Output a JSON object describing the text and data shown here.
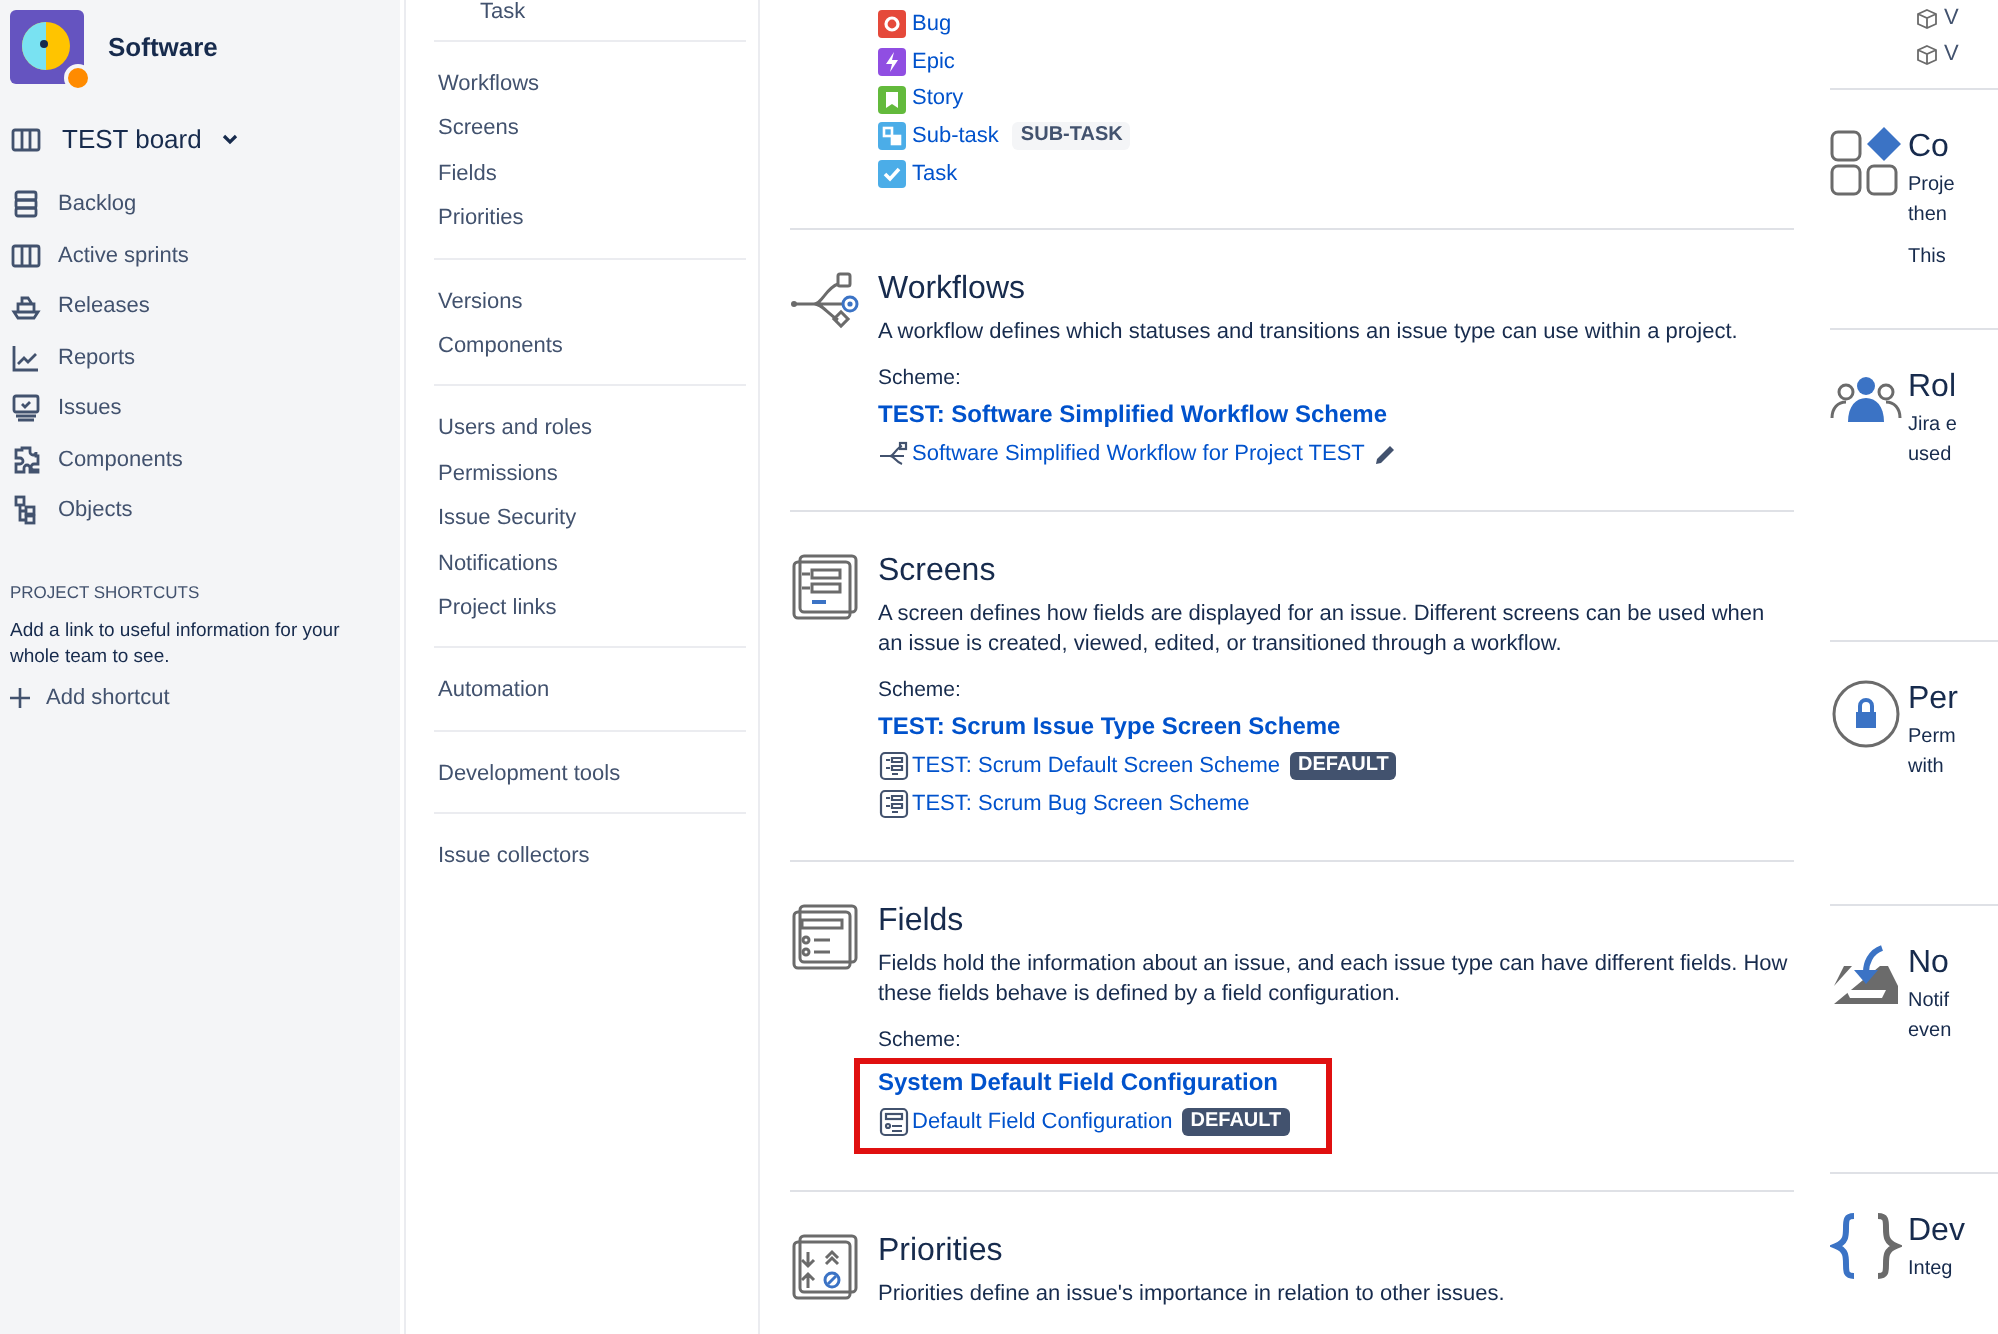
{
  "project": {
    "name": "Software"
  },
  "board": {
    "label": "TEST board"
  },
  "sidebar": {
    "items": [
      {
        "label": "Backlog",
        "kind": "backlog",
        "selected": false
      },
      {
        "label": "Active sprints",
        "kind": "sprints",
        "selected": false
      },
      {
        "label": "Releases",
        "kind": "releases",
        "selected": false
      },
      {
        "label": "Reports",
        "kind": "reports",
        "selected": false
      },
      {
        "label": "Issues",
        "kind": "issues",
        "selected": false
      },
      {
        "label": "Components",
        "kind": "components",
        "selected": false
      },
      {
        "label": "Objects",
        "kind": "objects",
        "selected": false
      }
    ]
  },
  "shortcuts": {
    "heading": "PROJECT SHORTCUTS",
    "text": "Add a link to useful information for your whole team to see.",
    "add": "Add shortcut"
  },
  "settings_nav": {
    "top_item": "Task",
    "groups": [
      [
        "Workflows",
        "Screens",
        "Fields",
        "Priorities"
      ],
      [
        "Versions",
        "Components"
      ],
      [
        "Users and roles",
        "Permissions",
        "Issue Security",
        "Notifications",
        "Project links"
      ],
      [
        "Automation"
      ],
      [
        "Development tools"
      ],
      [
        "Issue collectors"
      ]
    ]
  },
  "issue_types": [
    {
      "name": "Bug",
      "kind": "bug"
    },
    {
      "name": "Epic",
      "kind": "epic"
    },
    {
      "name": "Story",
      "kind": "story"
    },
    {
      "name": "Sub-task",
      "kind": "subtask",
      "badge": "SUB-TASK"
    },
    {
      "name": "Task",
      "kind": "task"
    }
  ],
  "sections": [
    {
      "kind": "workflows",
      "title": "Workflows",
      "description": "A workflow defines which statuses and transitions an issue type can use within a project.",
      "scheme_label": "Scheme:",
      "scheme": "TEST: Software Simplified Workflow Scheme",
      "highlighted": false,
      "items": [
        {
          "kind": "workflow",
          "name": "Software Simplified Workflow for Project TEST",
          "editable": true
        }
      ]
    },
    {
      "kind": "screens",
      "title": "Screens",
      "description": "A screen defines how fields are displayed for an issue. Different screens can be used when an issue is created, viewed, edited, or transitioned through a workflow.",
      "scheme_label": "Scheme:",
      "scheme": "TEST: Scrum Issue Type Screen Scheme",
      "highlighted": false,
      "items": [
        {
          "kind": "screen",
          "name": "TEST: Scrum Default Screen Scheme",
          "badge": "DEFAULT"
        },
        {
          "kind": "screen",
          "name": "TEST: Scrum Bug Screen Scheme"
        }
      ]
    },
    {
      "kind": "fields",
      "title": "Fields",
      "description": "Fields hold the information about an issue, and each issue type can have different fields. How these fields behave is defined by a field configuration.",
      "scheme_label": "Scheme:",
      "scheme": "System Default Field Configuration",
      "highlighted": true,
      "items": [
        {
          "kind": "field",
          "name": "Default Field Configuration",
          "badge": "DEFAULT"
        }
      ]
    },
    {
      "kind": "priorities",
      "title": "Priorities",
      "description": "Priorities define an issue's importance in relation to other issues."
    }
  ],
  "right_column": {
    "top_items": [
      "V",
      "V"
    ],
    "sections": [
      {
        "kind": "components",
        "title": "Co",
        "lines": [
          "Proje",
          "then"
        ],
        "note": "This"
      },
      {
        "kind": "roles",
        "title": "Rol",
        "lines": [
          "Jira e",
          "used"
        ]
      },
      {
        "kind": "permissions",
        "title": "Per",
        "lines": [
          "Perm",
          "with"
        ]
      },
      {
        "kind": "notifications",
        "title": "No",
        "lines": [
          "Notif",
          "even"
        ]
      },
      {
        "kind": "development",
        "title": "Dev",
        "lines": [
          "Integ"
        ]
      }
    ]
  }
}
